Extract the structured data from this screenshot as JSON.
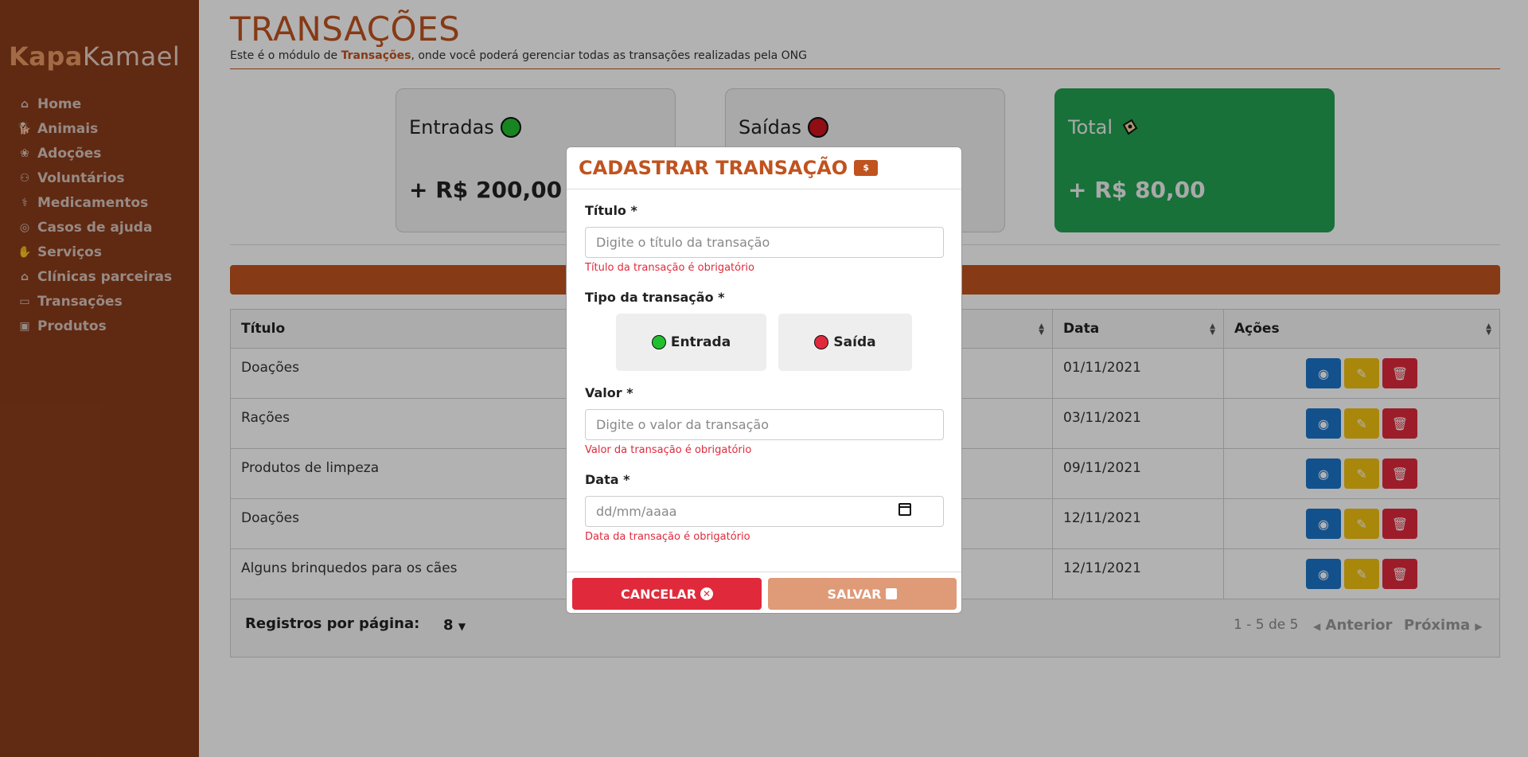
{
  "brand": {
    "part1": "Kapa",
    "part2": "Kamael"
  },
  "sidebar": {
    "items": [
      {
        "label": "Home",
        "icon": "home-icon"
      },
      {
        "label": "Animais",
        "icon": "dog-icon"
      },
      {
        "label": "Adoções",
        "icon": "paw-icon"
      },
      {
        "label": "Voluntários",
        "icon": "people-icon"
      },
      {
        "label": "Medicamentos",
        "icon": "pills-icon"
      },
      {
        "label": "Casos de ajuda",
        "icon": "life-ring-icon"
      },
      {
        "label": "Serviços",
        "icon": "hand-holding-icon"
      },
      {
        "label": "Clínicas parceiras",
        "icon": "clinic-icon"
      },
      {
        "label": "Transações",
        "icon": "money-check-icon"
      },
      {
        "label": "Produtos",
        "icon": "box-icon"
      }
    ]
  },
  "header": {
    "title": "TRANSAÇÕES",
    "subtitle_pre": "Este é o módulo de ",
    "subtitle_bold": "Transações",
    "subtitle_post": ", onde você poderá gerenciar todas as transações realizadas pela ONG"
  },
  "cards": [
    {
      "label": "Entradas",
      "value": "+ R$ 200,00",
      "dot_color": "#22c02f"
    },
    {
      "label": "Saídas",
      "value": "",
      "dot_color": "#d0141e"
    },
    {
      "label": "Total",
      "value": "+ R$ 80,00"
    }
  ],
  "table": {
    "headers": [
      "Título",
      "Data",
      "Ações"
    ],
    "rows": [
      {
        "title": "Doações",
        "date": "01/11/2021"
      },
      {
        "title": "Rações",
        "date": "03/11/2021"
      },
      {
        "title": "Produtos de limpeza",
        "date": "09/11/2021"
      },
      {
        "title": "Doações",
        "date": "12/11/2021"
      },
      {
        "title": "Alguns brinquedos para os cães",
        "date": "12/11/2021"
      }
    ],
    "footer": {
      "per_page_label": "Registros por página:",
      "per_page_value": "8",
      "page_info": "1 - 5 de 5",
      "prev": "Anterior",
      "next": "Próxima"
    }
  },
  "modal": {
    "title": "CADASTRAR TRANSAÇÃO",
    "title_icon_text": "$",
    "fields": {
      "titulo": {
        "label": "Título *",
        "placeholder": "Digite o título da transação",
        "error": "Título da transação é obrigatório"
      },
      "tipo": {
        "label": "Tipo da transação *",
        "options": [
          {
            "label": "Entrada",
            "color": "#22c02f"
          },
          {
            "label": "Saída",
            "color": "#e02a3c"
          }
        ]
      },
      "valor": {
        "label": "Valor *",
        "placeholder": "Digite o valor da transação",
        "error": "Valor da transação é obrigatório"
      },
      "data": {
        "label": "Data *",
        "placeholder": "dd/mm/aaaa",
        "error": "Data da transação é obrigatório"
      }
    },
    "cancel_label": "CANCELAR",
    "save_label": "SALVAR"
  }
}
